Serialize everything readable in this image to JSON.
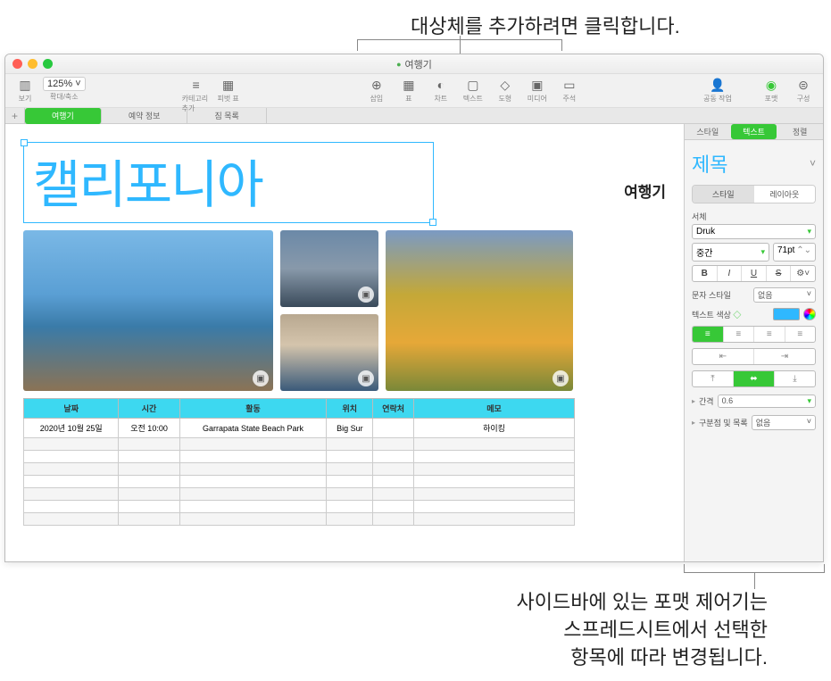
{
  "callout_top": "대상체를 추가하려면 클릭합니다.",
  "callout_bottom_l1": "사이드바에 있는 포맷 제어기는",
  "callout_bottom_l2": "스프레드시트에서 선택한",
  "callout_bottom_l3": "항목에 따라 변경됩니다.",
  "doc_title": "여행기",
  "toolbar": {
    "view": "보기",
    "zoom": "125%",
    "zoom_label": "확대/축소",
    "category": "카테고리 추가",
    "pivot": "피벗 표",
    "insert": "삽입",
    "table": "표",
    "chart": "차트",
    "text": "텍스트",
    "shape": "도형",
    "media": "미디어",
    "comment": "주석",
    "collab": "공동 작업",
    "format": "포맷",
    "organize": "구성"
  },
  "sheets": [
    "여행기",
    "예약 정보",
    "짐 목록"
  ],
  "content": {
    "title": "캘리포니아",
    "subtitle": "여행기"
  },
  "table": {
    "headers": [
      "날짜",
      "시간",
      "활동",
      "위치",
      "연락처",
      "메모"
    ],
    "rows": [
      [
        "2020년 10월 25일",
        "오전 10:00",
        "Garrapata State Beach Park",
        "Big Sur",
        "",
        "하이킹"
      ]
    ]
  },
  "inspector": {
    "tabs": [
      "스타일",
      "텍스트",
      "정렬"
    ],
    "heading": "제목",
    "subtabs": [
      "스타일",
      "레이아웃"
    ],
    "font_label": "서체",
    "font": "Druk",
    "weight": "중간",
    "size": "71pt",
    "bold": "B",
    "italic": "I",
    "underline": "U",
    "strike": "S",
    "char_style_label": "문자 스타일",
    "char_style_value": "없음",
    "text_color_label": "텍스트 색상",
    "spacing_label": "간격",
    "spacing_value": "0.6",
    "bullets_label": "구분점 및 목록",
    "bullets_value": "없음"
  }
}
